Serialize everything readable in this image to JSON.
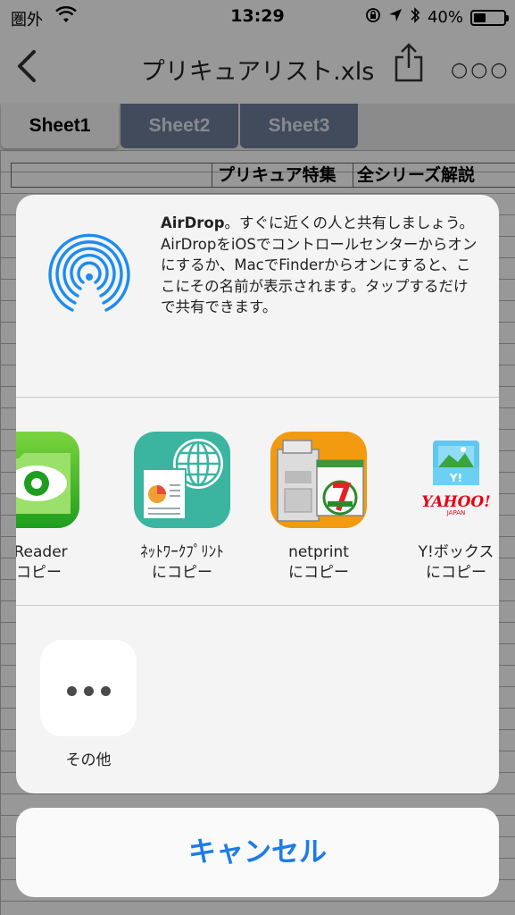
{
  "status_bar": {
    "carrier": "圏外",
    "time": "13:29",
    "battery": "40%",
    "battery_level": 0.4
  },
  "nav": {
    "title": "プリキュアリスト.xls"
  },
  "tabs": [
    {
      "label": "Sheet1",
      "active": true
    },
    {
      "label": "Sheet2",
      "active": false
    },
    {
      "label": "Sheet3",
      "active": false
    }
  ],
  "sheet": {
    "header_col1": "プリキュア特集",
    "header_col2": "全シリーズ解説"
  },
  "airdrop": {
    "title": "AirDrop",
    "text": "。すぐに近くの人と共有しましょう。AirDropをiOSでコントロールセンターからオンにするか、MacでFinderからオンにすると、ここにその名前が表示されます。タップするだけで共有できます。"
  },
  "apps": [
    {
      "name": "odReader",
      "action": "にコピー"
    },
    {
      "name": "ﾈｯﾄﾜｰｸﾌﾟﾘﾝﾄ",
      "action": "にコピー"
    },
    {
      "name": "netprint",
      "action": "にコピー"
    },
    {
      "name": "Y!ボックス",
      "action": "にコピー"
    }
  ],
  "more": {
    "label": "その他"
  },
  "cancel_label": "キャンセル",
  "colors": {
    "accent": "#1d7ce6",
    "tab_inactive": "#6e7d99",
    "airdrop_blue": "#1d8cf0"
  }
}
